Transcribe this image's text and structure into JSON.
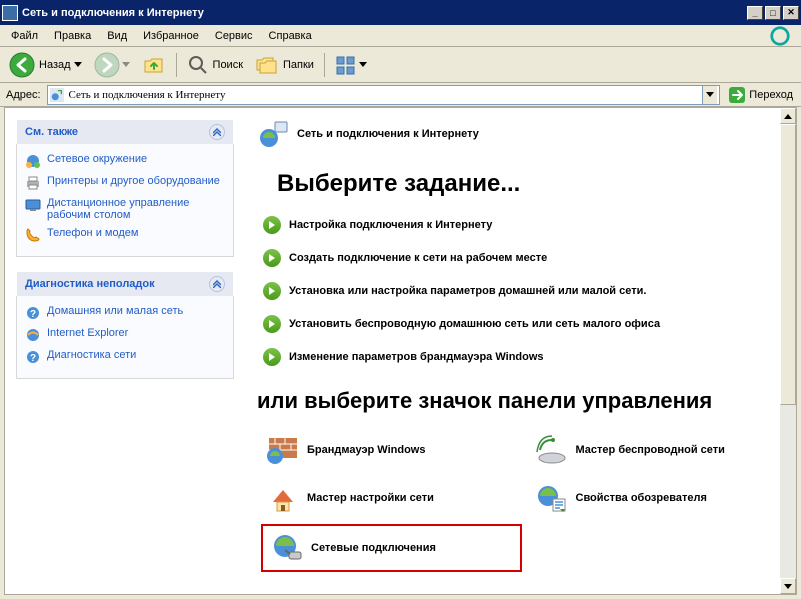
{
  "titlebar": {
    "title": "Сеть и подключения к Интернету",
    "min_tip": "Minimize",
    "max_tip": "Maximize",
    "close_tip": "Close"
  },
  "menu": {
    "file": "Файл",
    "edit": "Правка",
    "view": "Вид",
    "favorites": "Избранное",
    "tools": "Сервис",
    "help": "Справка"
  },
  "toolbar": {
    "back": "Назад",
    "search": "Поиск",
    "folders": "Папки"
  },
  "address": {
    "label": "Адрес:",
    "value": "Сеть и подключения к Интернету",
    "go": "Переход"
  },
  "sidebar": {
    "box1": {
      "title": "См. также",
      "items": [
        "Сетевое окружение",
        "Принтеры и другое оборудование",
        "Дистанционное управление рабочим столом",
        "Телефон и модем"
      ]
    },
    "box2": {
      "title": "Диагностика неполадок",
      "items": [
        "Домашняя или малая сеть",
        "Internet Explorer",
        "Диагностика сети"
      ]
    }
  },
  "main": {
    "title": "Сеть и подключения к Интернету",
    "task_header": "Выберите задание...",
    "tasks": [
      "Настройка подключения к Интернету",
      "Создать подключение к сети на рабочем месте",
      "Установка или настройка параметров домашней или малой сети.",
      "Установить беспроводную домашнюю сеть или сеть малого офиса",
      "Изменение параметров брандмауэра Windows"
    ],
    "cp_header": "или выберите значок панели управления",
    "cp_items": [
      "Брандмауэр Windows",
      "Мастер беспроводной сети",
      "Мастер настройки сети",
      "Свойства обозревателя",
      "Сетевые подключения"
    ]
  }
}
